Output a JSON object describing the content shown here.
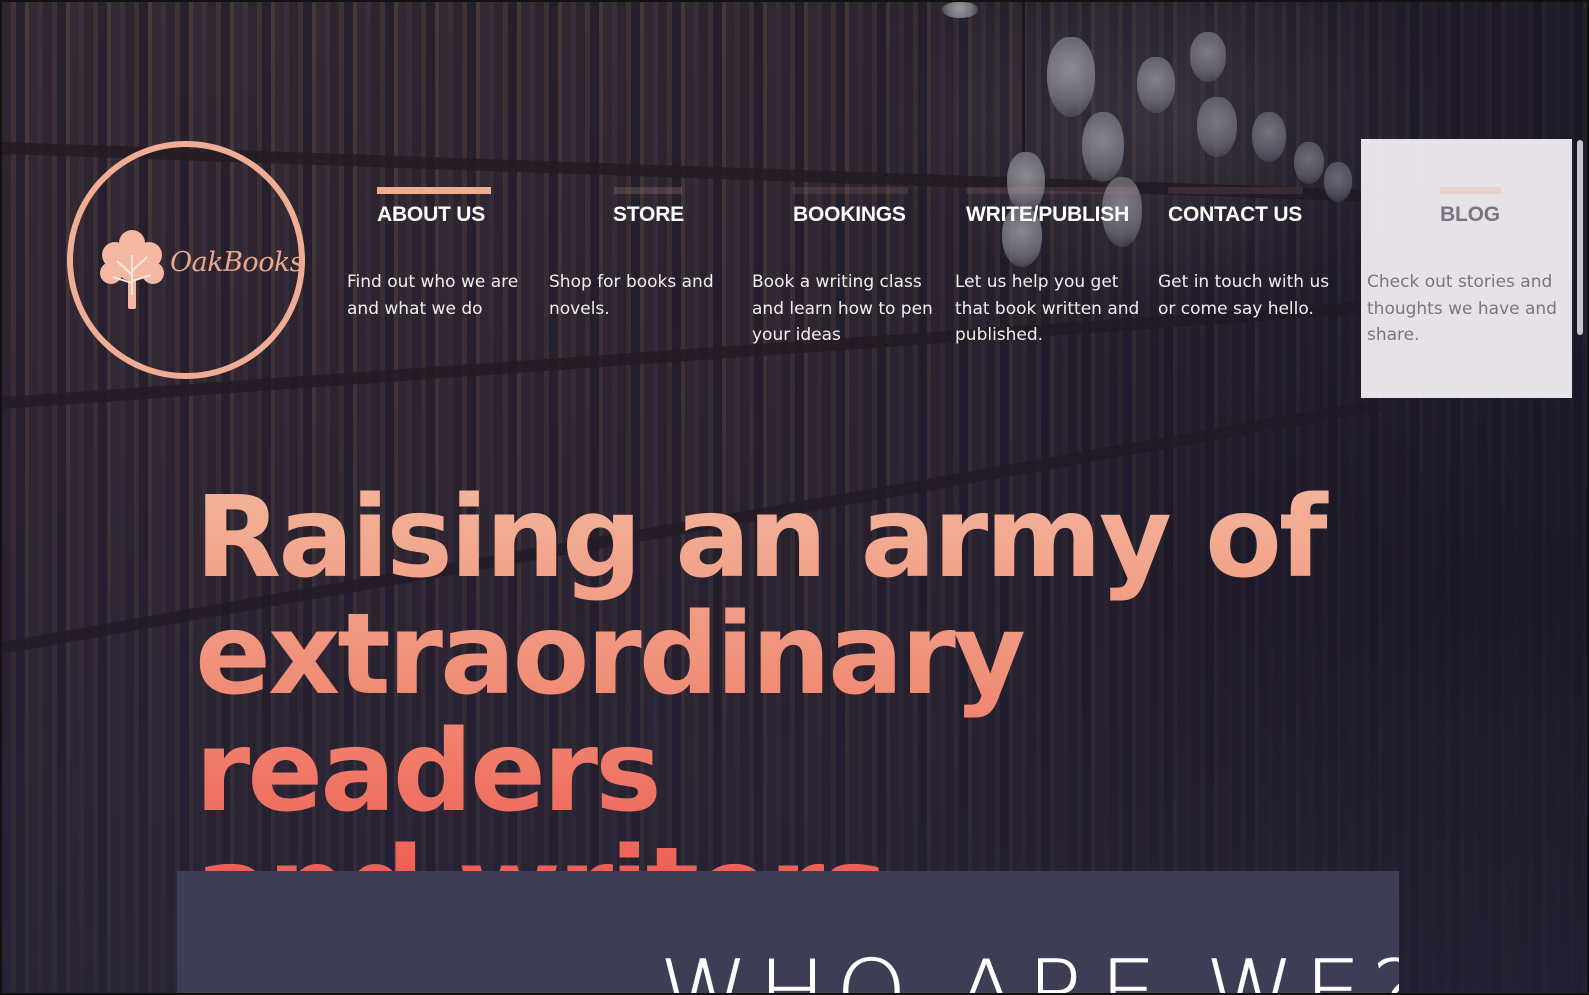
{
  "logo": {
    "text": "OakBooks",
    "circle_color": "#f0ad93"
  },
  "nav": [
    {
      "label": "ABOUT US",
      "description": "Find out who we are and what we do",
      "active": true
    },
    {
      "label": "STORE",
      "description": "Shop for books and novels."
    },
    {
      "label": "BOOKINGS",
      "description": "Book a writing class and learn how to pen your ideas"
    },
    {
      "label": "WRITE/PUBLISH",
      "description": "Let us help you get that book written and published."
    },
    {
      "label": "CONTACT US",
      "description": "Get in touch with us or come say hello."
    },
    {
      "label": "BLOG",
      "description": "Check out stories and thoughts we have and share.",
      "hovered": true
    }
  ],
  "hero": {
    "headline_lines": [
      "Raising an army of",
      "extraordinary readers",
      "and writers."
    ]
  },
  "who_section": {
    "title": "WHO ARE WE?"
  },
  "colors": {
    "accent": "#f0ad93",
    "headline_top": "#f3b59b",
    "headline_bottom": "#ee4d47",
    "section_bg": "#3e3d56",
    "hover_panel": "#f0eef2"
  },
  "icons": [
    "oak-tree-icon"
  ]
}
